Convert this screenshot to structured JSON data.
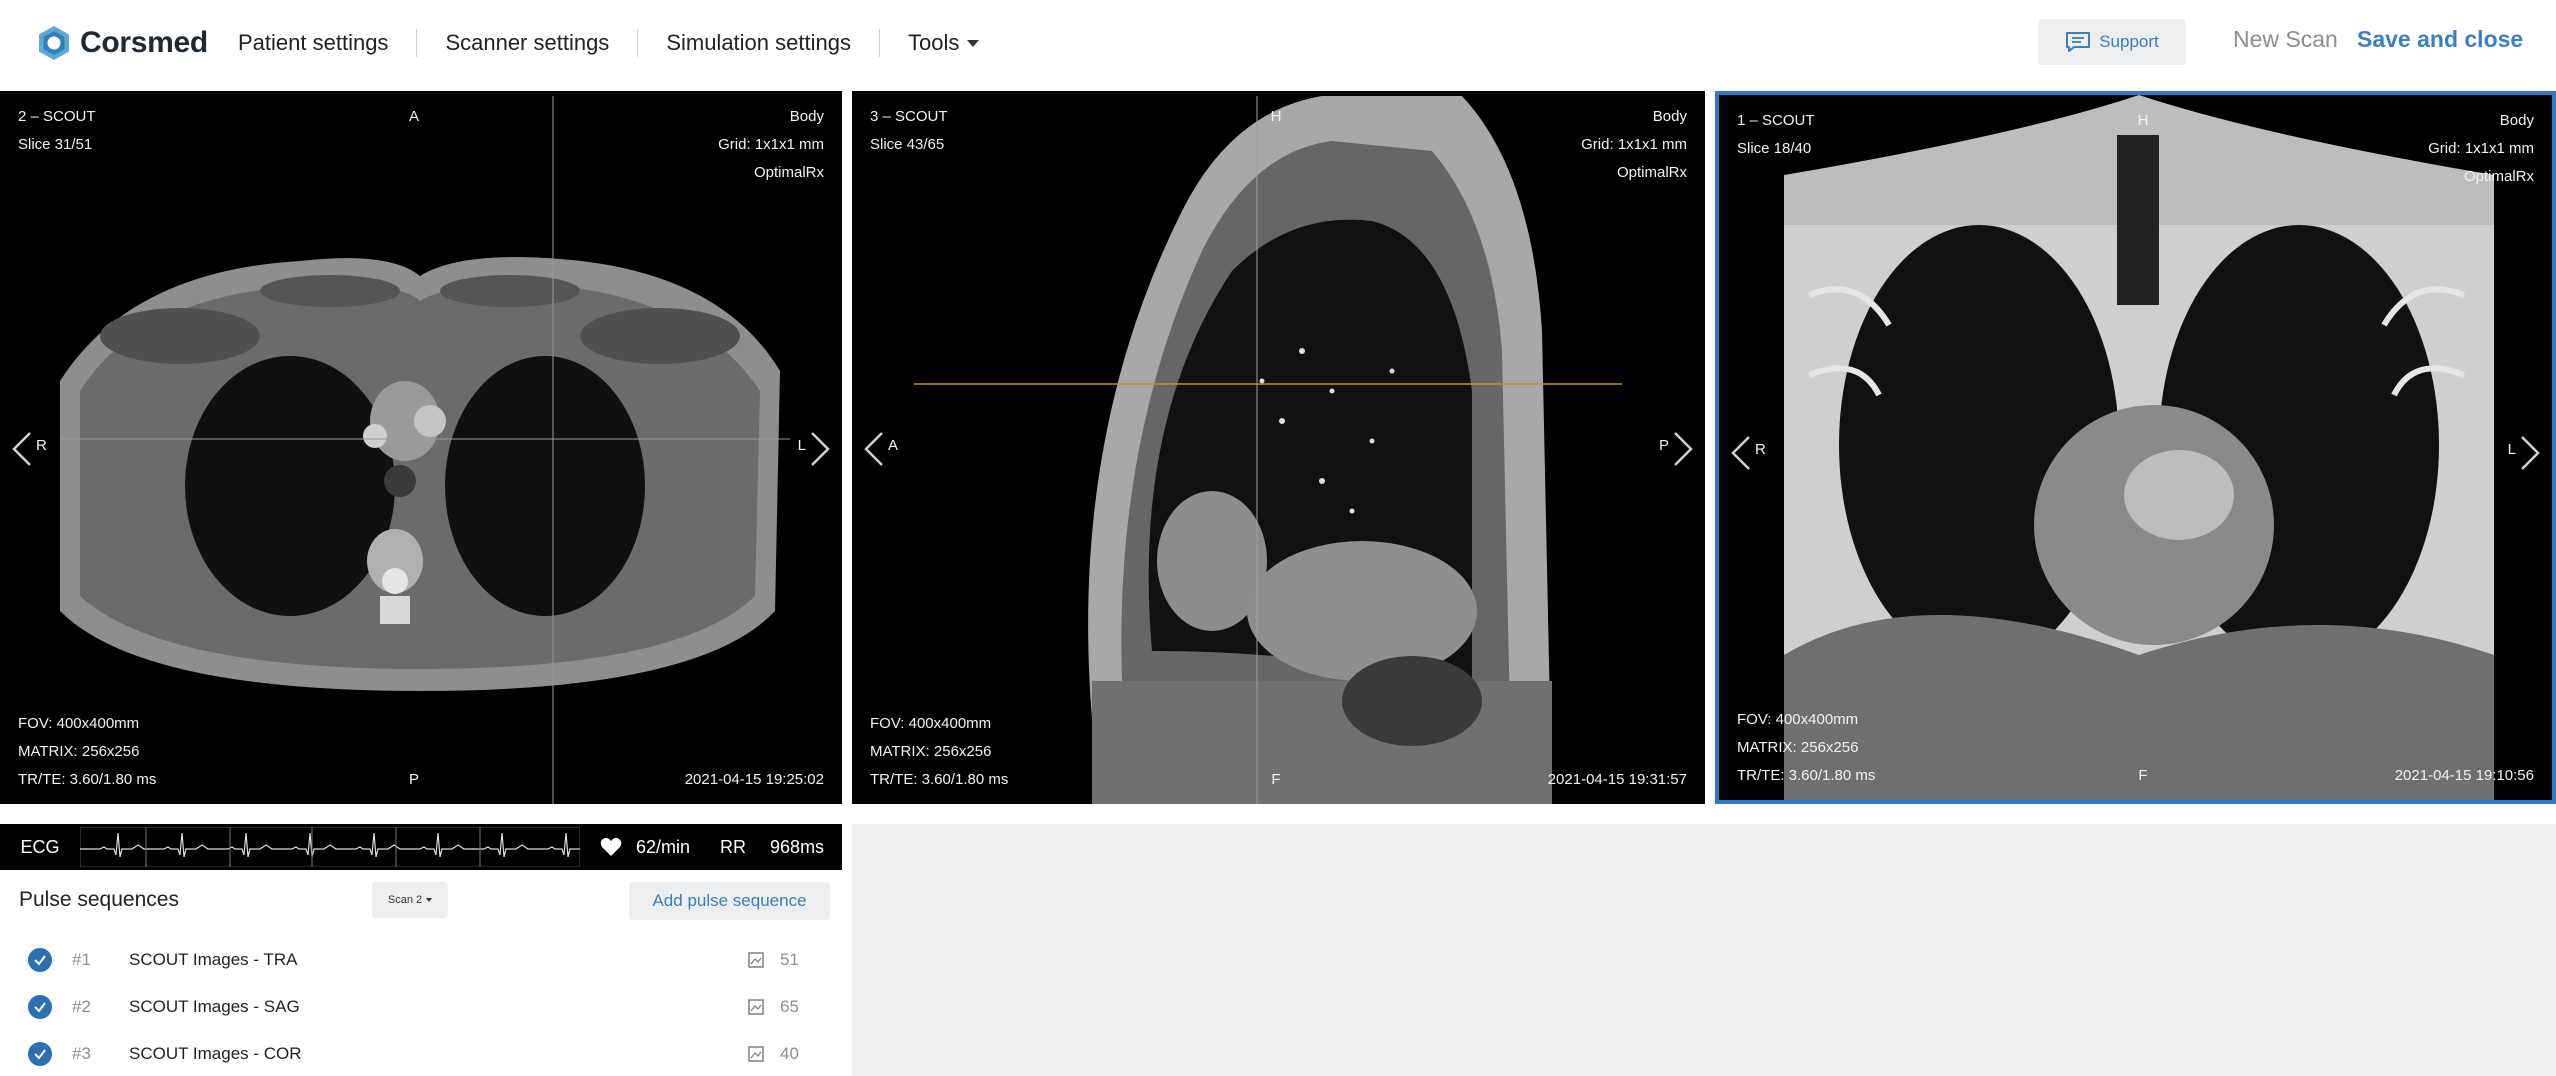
{
  "header": {
    "brand": "Corsmed",
    "nav": [
      "Patient settings",
      "Scanner settings",
      "Simulation settings",
      "Tools"
    ],
    "support_label": "Support",
    "new_scan_label": "New Scan",
    "save_close_label": "Save and close"
  },
  "viewports": [
    {
      "title": "2 – SCOUT",
      "slice": "Slice 31/51",
      "top_center": "A",
      "bottom_center": "P",
      "left_label": "R",
      "right_label": "L",
      "coil": "Body",
      "grid": "Grid: 1x1x1 mm",
      "recon": "OptimalRx",
      "fov": "FOV: 400x400mm",
      "matrix": "MATRIX: 256x256",
      "trte": "TR/TE: 3.60/1.80 ms",
      "timestamp": "2021-04-15 19:25:02"
    },
    {
      "title": "3 – SCOUT",
      "slice": "Slice 43/65",
      "top_center": "H",
      "bottom_center": "F",
      "left_label": "A",
      "right_label": "P",
      "coil": "Body",
      "grid": "Grid: 1x1x1 mm",
      "recon": "OptimalRx",
      "fov": "FOV: 400x400mm",
      "matrix": "MATRIX: 256x256",
      "trte": "TR/TE: 3.60/1.80 ms",
      "timestamp": "2021-04-15 19:31:57"
    },
    {
      "title": "1 – SCOUT",
      "slice": "Slice 18/40",
      "top_center": "H",
      "bottom_center": "F",
      "left_label": "R",
      "right_label": "L",
      "coil": "Body",
      "grid": "Grid: 1x1x1 mm",
      "recon": "OptimalRx",
      "fov": "FOV: 400x400mm",
      "matrix": "MATRIX: 256x256",
      "trte": "TR/TE: 3.60/1.80 ms",
      "timestamp": "2021-04-15 19:10:56"
    }
  ],
  "ecg": {
    "label": "ECG",
    "heart_rate": "62/min",
    "rr_label": "RR",
    "rr_value": "968ms"
  },
  "pulse_sequences": {
    "title": "Pulse sequences",
    "scan_select": "Scan 2",
    "add_label": "Add pulse sequence",
    "items": [
      {
        "num": "#1",
        "name": "SCOUT Images - TRA",
        "count": "51"
      },
      {
        "num": "#2",
        "name": "SCOUT Images - SAG",
        "count": "65"
      },
      {
        "num": "#3",
        "name": "SCOUT Images - COR",
        "count": "40"
      }
    ]
  },
  "colors": {
    "accent": "#3a7fc1",
    "active_border": "#2d7cc7",
    "check": "#2d6fb3",
    "slice_line": "#d4862a"
  },
  "icons": [
    "corsmed-logo-icon",
    "chat-icon",
    "chevron-left-icon",
    "chevron-right-icon",
    "heart-icon",
    "check-icon",
    "image-icon"
  ]
}
